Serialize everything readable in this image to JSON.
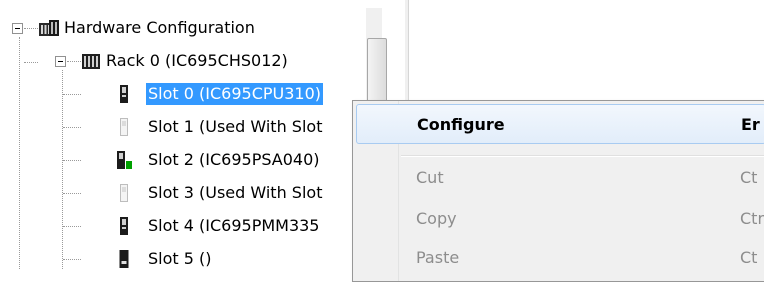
{
  "tree": {
    "root": {
      "label": "Hardware Configuration",
      "icon": "hardware-configuration-icon",
      "expanded": true
    },
    "rack": {
      "label": "Rack 0 (IC695CHS012)",
      "icon": "rack-icon",
      "expanded": true
    },
    "slots": [
      {
        "label": "Slot 0 (IC695CPU310)",
        "icon": "cpu-module-icon",
        "selected": true
      },
      {
        "label": "Slot 1 (Used With Slot",
        "icon": "empty-slot-icon"
      },
      {
        "label": "Slot 2 (IC695PSA040)",
        "icon": "power-supply-module-icon"
      },
      {
        "label": "Slot 3 (Used With Slot",
        "icon": "empty-slot-icon"
      },
      {
        "label": "Slot 4 (IC695PMM335",
        "icon": "module-icon"
      },
      {
        "label": "Slot 5 ()",
        "icon": "module-icon"
      }
    ]
  },
  "context_menu": {
    "items": [
      {
        "label": "Configure",
        "shortcut": "Er",
        "default": true,
        "highlighted": true,
        "enabled": true
      },
      {
        "label": "Cut",
        "shortcut": "Ct",
        "enabled": false
      },
      {
        "label": "Copy",
        "shortcut": "Ctr",
        "enabled": false
      },
      {
        "label": "Paste",
        "shortcut": "Ct",
        "enabled": false
      }
    ]
  },
  "colors": {
    "selection": "#3399ff",
    "menu_background": "#f0f0f0",
    "menu_highlight_border": "#a8cbf1",
    "disabled_text": "#8d8d8d",
    "power_led": "#00a000"
  }
}
